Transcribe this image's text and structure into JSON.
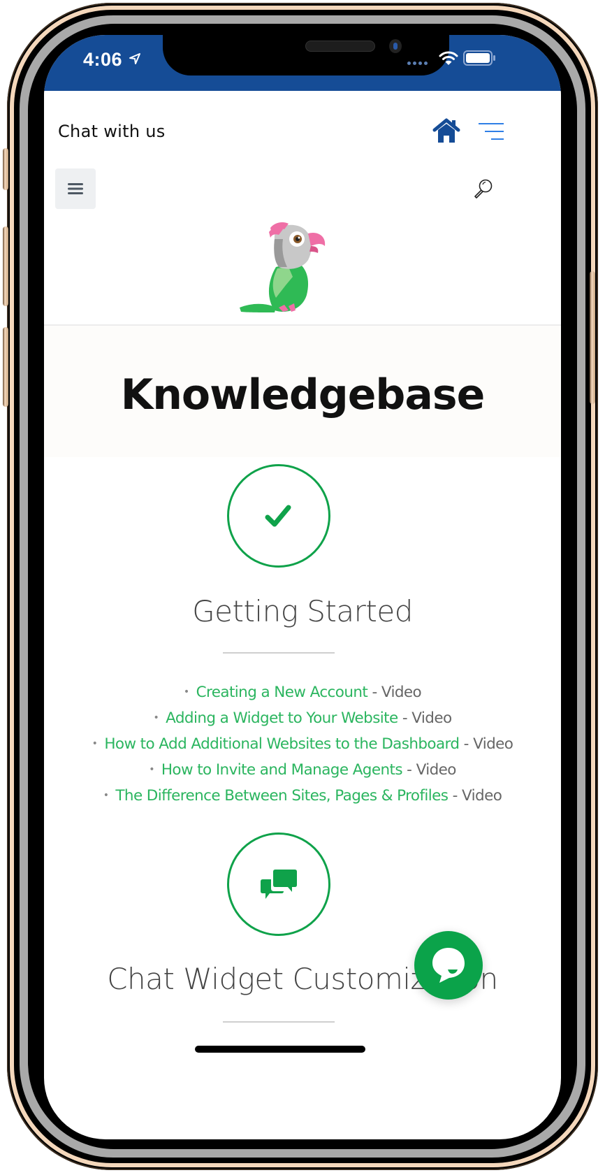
{
  "status_bar": {
    "time": "4:06",
    "icons": [
      "location-arrow-icon",
      "cellular-signal-icon",
      "wifi-icon",
      "battery-icon"
    ]
  },
  "header": {
    "title": "Chat with us",
    "icons": [
      "home-icon",
      "menu-lines-icon"
    ]
  },
  "toolbar": {
    "icons": [
      "hamburger-menu-icon",
      "search-icon"
    ]
  },
  "logo": {
    "icon": "parrot-logo-icon"
  },
  "hero": {
    "title": "Knowledgebase"
  },
  "categories": [
    {
      "icon": "checkmark-icon",
      "title": "Getting Started",
      "articles": [
        {
          "label": "Creating a New Account",
          "suffix": " - Video"
        },
        {
          "label": "Adding a Widget to Your Website",
          "suffix": " - Video"
        },
        {
          "label": "How to Add Additional Websites to the Dashboard",
          "suffix": " - Video"
        },
        {
          "label": "How to Invite and Manage Agents",
          "suffix": " - Video"
        },
        {
          "label": "The Difference Between Sites, Pages & Profiles",
          "suffix": " - Video"
        }
      ]
    },
    {
      "icon": "chat-bubbles-icon",
      "title": "Chat Widget Customization",
      "articles": []
    }
  ],
  "chat_widget": {
    "icon": "chat-bubble-icon"
  },
  "colors": {
    "status_bar": "#154c96",
    "accent_green": "#0ba34a",
    "link_green": "#2bb55f",
    "home_icon_blue": "#154c96",
    "menu_icon_blue": "#2f7fe6"
  }
}
